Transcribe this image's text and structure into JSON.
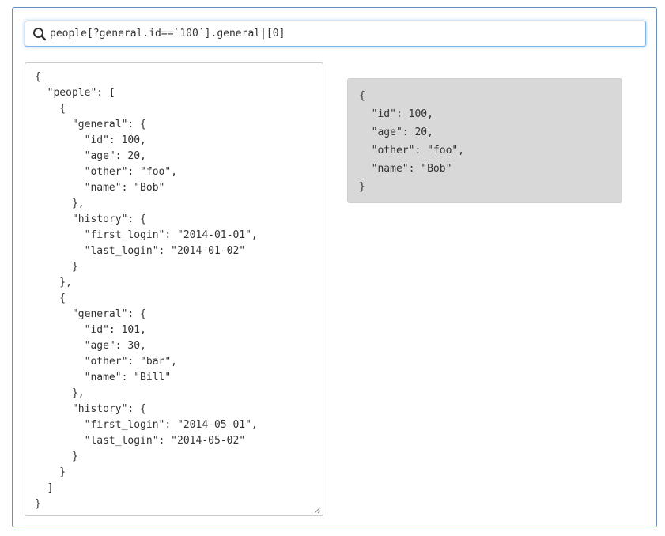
{
  "search": {
    "value": "people[?general.id==`100`].general|[0]"
  },
  "source_json": "{\n  \"people\": [\n    {\n      \"general\": {\n        \"id\": 100,\n        \"age\": 20,\n        \"other\": \"foo\",\n        \"name\": \"Bob\"\n      },\n      \"history\": {\n        \"first_login\": \"2014-01-01\",\n        \"last_login\": \"2014-01-02\"\n      }\n    },\n    {\n      \"general\": {\n        \"id\": 101,\n        \"age\": 30,\n        \"other\": \"bar\",\n        \"name\": \"Bill\"\n      },\n      \"history\": {\n        \"first_login\": \"2014-05-01\",\n        \"last_login\": \"2014-05-02\"\n      }\n    }\n  ]\n}",
  "result_json": "{\n  \"id\": 100,\n  \"age\": 20,\n  \"other\": \"foo\",\n  \"name\": \"Bob\"\n}",
  "colors": {
    "panel_border": "#6a8fb8",
    "focus_border": "#7fb5e5",
    "result_background": "#d8d8d8"
  }
}
